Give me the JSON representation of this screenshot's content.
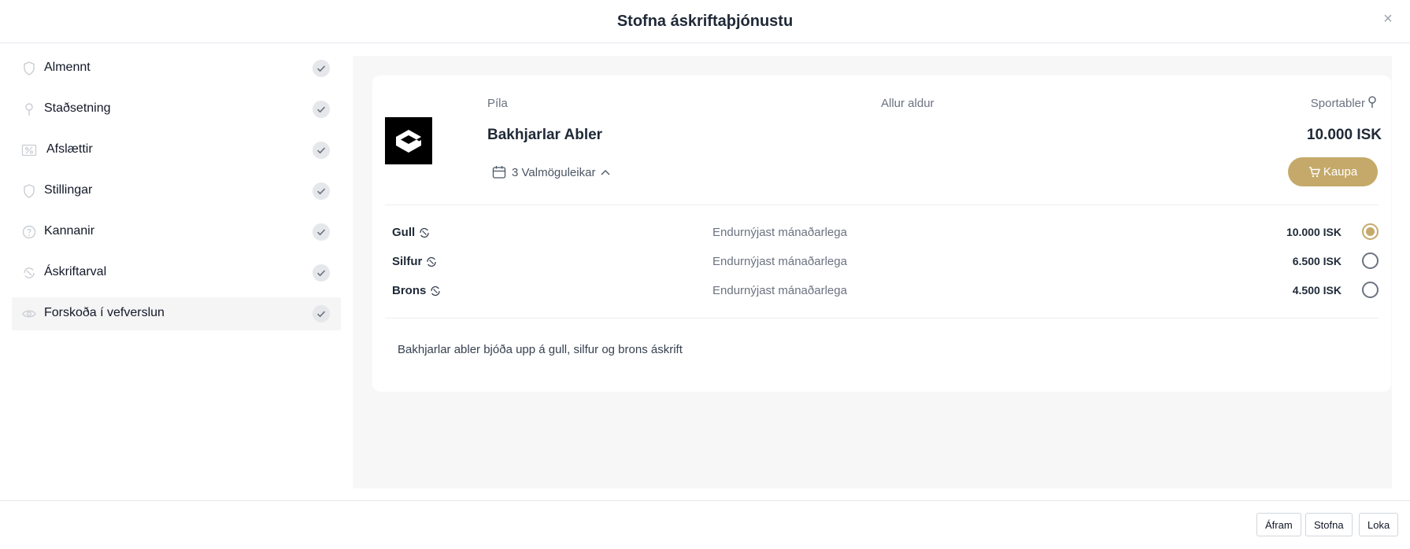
{
  "modal": {
    "title": "Stofna áskriftaþjónustu",
    "close_glyph": "×"
  },
  "sidebar": {
    "items": [
      {
        "label": "Almennt",
        "icon": "shield-icon"
      },
      {
        "label": "Staðsetning",
        "icon": "map-pin-icon"
      },
      {
        "label": "Afslættir",
        "icon": "percent-icon"
      },
      {
        "label": "Stillingar",
        "icon": "shield-icon"
      },
      {
        "label": "Kannanir",
        "icon": "question-circle-icon"
      },
      {
        "label": "Áskriftarval",
        "icon": "recurring-icon"
      },
      {
        "label": "Forskoða í vefverslun",
        "icon": "eye-icon",
        "active": true
      }
    ]
  },
  "product": {
    "category": "Píla",
    "age": "Allur aldur",
    "organizer": "Sportabler",
    "title": "Bakhjarlar Abler",
    "price": "10.000 ISK",
    "options_label": "3 Valmöguleikar",
    "buy_label": "Kaupa",
    "accent_color": "#c4a96a",
    "description": "Bakhjarlar abler bjóða upp á gull, silfur og brons áskrift"
  },
  "tiers": [
    {
      "name": "Gull",
      "renewal": "Endurnýjast mánaðarlega",
      "price": "10.000 ISK",
      "selected": true
    },
    {
      "name": "Silfur",
      "renewal": "Endurnýjast mánaðarlega",
      "price": "6.500 ISK",
      "selected": false
    },
    {
      "name": "Brons",
      "renewal": "Endurnýjast mánaðarlega",
      "price": "4.500 ISK",
      "selected": false
    }
  ],
  "footer": {
    "next_label": "Áfram",
    "create_label": "Stofna",
    "close_label": "Loka"
  }
}
